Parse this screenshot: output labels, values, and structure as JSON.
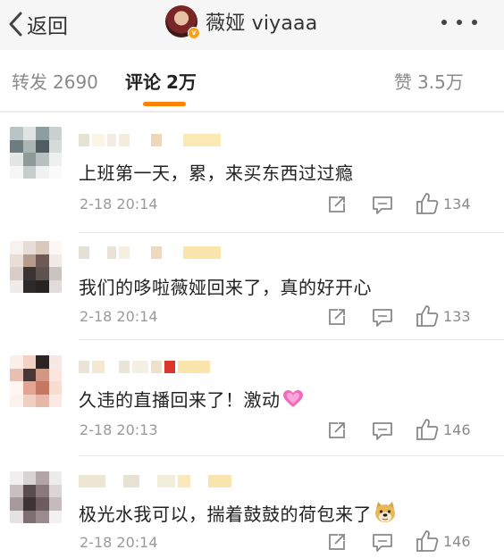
{
  "header": {
    "back_label": "返回",
    "profile_name": "薇娅 viyaaa",
    "verified_badge": "v"
  },
  "tabs": [
    {
      "label": "转发",
      "count": "2690"
    },
    {
      "label": "评论",
      "count": "2万"
    },
    {
      "label": "赞",
      "count": "3.5万"
    }
  ],
  "accent_color": "#ff8200",
  "comments": [
    {
      "text": "上班第一天，累，来买东西过过瘾",
      "time": "2-18 20:14",
      "likes": "134"
    },
    {
      "text": "我们的哆啦薇娅回来了，真的好开心",
      "time": "2-18 20:14",
      "likes": "133"
    },
    {
      "text": "久违的直播回来了！激动",
      "emoji": "pink-heart-icon",
      "time": "2-18 20:13",
      "likes": "146"
    },
    {
      "text": "极光水我可以，揣着鼓鼓的荷包来了",
      "emoji": "doge-icon",
      "time": "2-18 20:14",
      "likes": "146"
    }
  ]
}
